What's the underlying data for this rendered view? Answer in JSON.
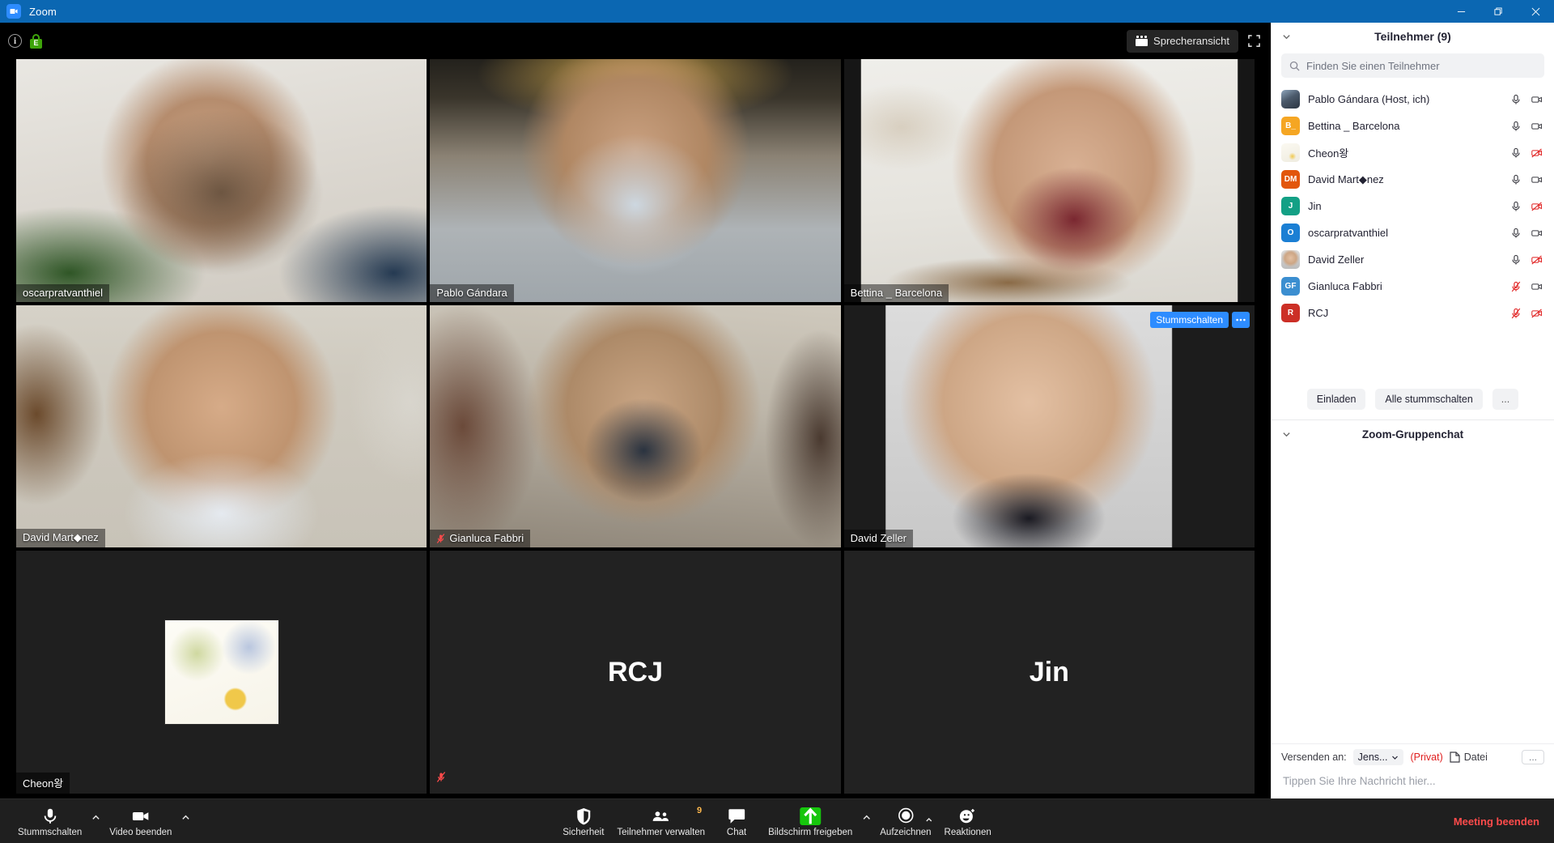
{
  "window": {
    "title": "Zoom",
    "minimize_label": "Minimieren",
    "maximize_label": "Maximieren",
    "close_label": "Schließen"
  },
  "stage": {
    "info_icon": "info-icon",
    "encryption_icon": "encryption-lock-icon",
    "encryption_letter": "E",
    "speaker_view_label": "Sprecheransicht",
    "fullscreen_label": "Vollbild",
    "hover_mute_label": "Stummschalten",
    "hover_more_label": "..."
  },
  "tiles": [
    {
      "name": "oscarpratvanthiel",
      "type": "video",
      "muted": false,
      "active": false
    },
    {
      "name": "Pablo Gándara",
      "type": "video",
      "muted": false,
      "active": false
    },
    {
      "name": "Bettina _ Barcelona",
      "type": "video",
      "muted": false,
      "active": true
    },
    {
      "name": "David Mart◆nez",
      "type": "video",
      "muted": false,
      "active": false
    },
    {
      "name": "Gianluca Fabbri",
      "type": "video",
      "muted": true,
      "active": false
    },
    {
      "name": "David Zeller",
      "type": "video",
      "muted": false,
      "active": false
    },
    {
      "name": "Cheon왕",
      "type": "image",
      "muted": false,
      "active": false
    },
    {
      "name": "RCJ",
      "type": "placeholder",
      "initials": "RCJ",
      "muted": true,
      "active": false
    },
    {
      "name": "Jin",
      "type": "placeholder",
      "initials": "Jin",
      "muted": false,
      "active": false
    }
  ],
  "panel": {
    "title": "Teilnehmer (9)",
    "collapse_icon": "chevron-down-icon",
    "search_placeholder": "Finden Sie einen Teilnehmer",
    "search_value": "",
    "participants": [
      {
        "name": "Pablo Gándara (Host, ich)",
        "avatar_type": "photo",
        "initials": "",
        "color": "#c9ccd1",
        "mic_muted": false,
        "video_off": false
      },
      {
        "name": "Bettina _ Barcelona",
        "avatar_type": "initials",
        "initials": "B_",
        "color": "#f5a623",
        "mic_muted": false,
        "video_off": false
      },
      {
        "name": "Cheon왕",
        "avatar_type": "photo-light",
        "initials": "",
        "color": "#f2efe6",
        "mic_muted": false,
        "video_off": true
      },
      {
        "name": "David Mart◆nez",
        "avatar_type": "initials",
        "initials": "DM",
        "color": "#e2560c",
        "mic_muted": false,
        "video_off": false
      },
      {
        "name": "Jin",
        "avatar_type": "initials",
        "initials": "J",
        "color": "#13a085",
        "mic_muted": false,
        "video_off": true
      },
      {
        "name": "oscarpratvanthiel",
        "avatar_type": "initials",
        "initials": "O",
        "color": "#1b7fd4",
        "mic_muted": false,
        "video_off": false
      },
      {
        "name": "David Zeller",
        "avatar_type": "photo",
        "initials": "",
        "color": "#cfcfcf",
        "mic_muted": false,
        "video_off": true
      },
      {
        "name": "Gianluca Fabbri",
        "avatar_type": "initials",
        "initials": "GF",
        "color": "#3b8ed0",
        "mic_muted": true,
        "video_off": false
      },
      {
        "name": "RCJ",
        "avatar_type": "initials",
        "initials": "R",
        "color": "#cc2f26",
        "mic_muted": true,
        "video_off": true
      }
    ],
    "actions": {
      "invite": "Einladen",
      "mute_all": "Alle stummschalten",
      "more": "..."
    }
  },
  "chat": {
    "title": "Zoom-Gruppenchat",
    "collapse_icon": "chevron-down-icon",
    "send_to_label": "Versenden an:",
    "recipient": "Jens...",
    "private_label": "(Privat)",
    "file_label": "Datei",
    "more_label": "...",
    "input_placeholder": "Tippen Sie Ihre Nachricht hier..."
  },
  "toolbar": {
    "mute": {
      "label": "Stummschalten",
      "icon": "microphone-icon"
    },
    "video": {
      "label": "Video beenden",
      "icon": "video-camera-icon"
    },
    "security": {
      "label": "Sicherheit",
      "icon": "shield-icon"
    },
    "participants": {
      "label": "Teilnehmer verwalten",
      "icon": "people-icon",
      "count": "9"
    },
    "chat": {
      "label": "Chat",
      "icon": "chat-bubble-icon"
    },
    "share": {
      "label": "Bildschirm freigeben",
      "icon": "share-screen-up-arrow-icon",
      "color": "#16c60c"
    },
    "record": {
      "label": "Aufzeichnen",
      "icon": "record-circle-icon"
    },
    "reactions": {
      "label": "Reaktionen",
      "icon": "smiley-plus-icon"
    },
    "end": {
      "label": "Meeting beenden",
      "color": "#ff4b4b"
    }
  }
}
